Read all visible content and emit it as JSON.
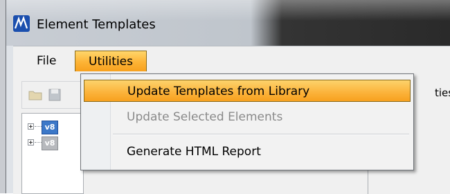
{
  "window": {
    "title": "Element Templates",
    "logo_icon": "microstation-logo-icon"
  },
  "menubar": {
    "file_label": "File",
    "utilities_label": "Utilities"
  },
  "toolbar": {
    "icons": [
      "open-folder-icon",
      "save-icon"
    ]
  },
  "tree": {
    "items": [
      {
        "label": "v8",
        "active": true
      },
      {
        "label": "v8",
        "active": false
      }
    ]
  },
  "right_pane": {
    "label_fragment": "ties"
  },
  "utilities_menu": {
    "items": [
      {
        "label": "Update Templates from Library",
        "state": "highlighted"
      },
      {
        "label": "Update Selected Elements",
        "state": "disabled"
      },
      {
        "label": "Generate HTML Report",
        "state": "normal"
      }
    ]
  },
  "colors": {
    "highlight": "#fbb23a",
    "disabled_text": "#8a8a8a",
    "tree_active": "#3c78c8"
  }
}
